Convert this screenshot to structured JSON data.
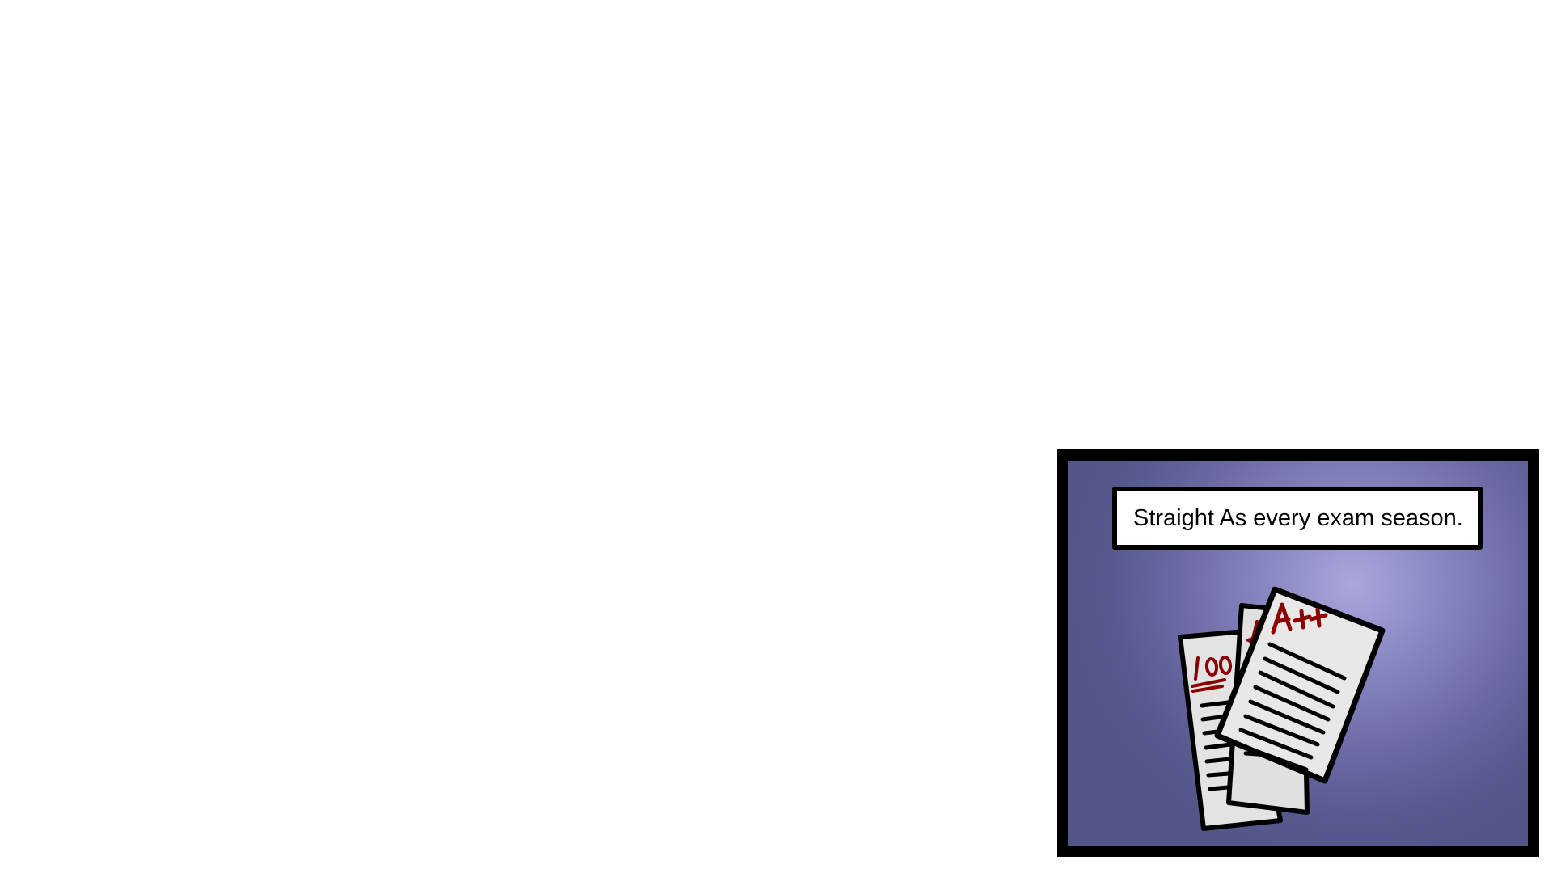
{
  "panel": {
    "caption": "Straight As every exam season.",
    "background_colors": [
      "#a9a7db",
      "#525689"
    ],
    "border_color": "#000000"
  },
  "illustration": {
    "name": "graded-exam-papers",
    "paper_color": "#e6e6e6",
    "ink_color": "#8b0000",
    "grades": [
      "100",
      "A",
      "A++"
    ]
  }
}
